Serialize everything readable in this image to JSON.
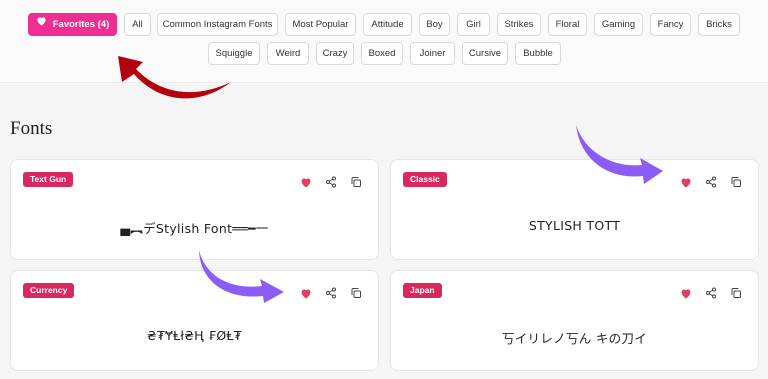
{
  "filters": {
    "favorites_label": "Favorites (4)",
    "row1": [
      "All",
      "Common Instagram Fonts",
      "Most Popular",
      "Attitude",
      "Boy",
      "Girl",
      "Strikes",
      "Floral",
      "Gaming",
      "Fancy",
      "Bricks"
    ],
    "row2": [
      "Squiggle",
      "Weird",
      "Crazy",
      "Boxed",
      "Joiner",
      "Cursive",
      "Bubble"
    ]
  },
  "section_title": "Fonts",
  "cards": [
    {
      "tag": "Text Gun",
      "sample": "▄︻デStylish Font══━一"
    },
    {
      "tag": "Classic",
      "sample": "STYLISH TOTT"
    },
    {
      "tag": "Currency",
      "sample": "₴₮ɎⱠł₴Ⱨ ₣ØⱠ₮"
    },
    {
      "tag": "Japan",
      "sample": "丂イリレノ丂ん キの刀イ"
    }
  ],
  "colors": {
    "accent_pink": "#ee2e92",
    "tag_red": "#d9285e",
    "heart": "#e0405f",
    "annotation_red": "#b3000f",
    "annotation_purple": "#8b5cf6"
  },
  "icons": [
    "heart-icon",
    "share-icon",
    "copy-icon"
  ]
}
